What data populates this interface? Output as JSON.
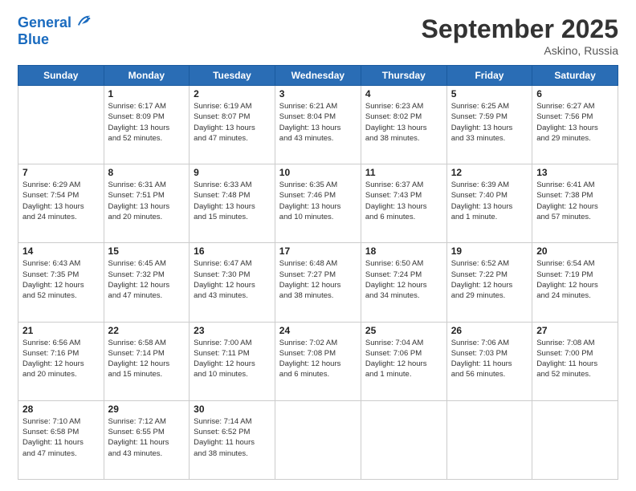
{
  "logo": {
    "line1": "General",
    "line2": "Blue"
  },
  "title": "September 2025",
  "location": "Askino, Russia",
  "headers": [
    "Sunday",
    "Monday",
    "Tuesday",
    "Wednesday",
    "Thursday",
    "Friday",
    "Saturday"
  ],
  "weeks": [
    [
      {
        "day": "",
        "info": ""
      },
      {
        "day": "1",
        "info": "Sunrise: 6:17 AM\nSunset: 8:09 PM\nDaylight: 13 hours\nand 52 minutes."
      },
      {
        "day": "2",
        "info": "Sunrise: 6:19 AM\nSunset: 8:07 PM\nDaylight: 13 hours\nand 47 minutes."
      },
      {
        "day": "3",
        "info": "Sunrise: 6:21 AM\nSunset: 8:04 PM\nDaylight: 13 hours\nand 43 minutes."
      },
      {
        "day": "4",
        "info": "Sunrise: 6:23 AM\nSunset: 8:02 PM\nDaylight: 13 hours\nand 38 minutes."
      },
      {
        "day": "5",
        "info": "Sunrise: 6:25 AM\nSunset: 7:59 PM\nDaylight: 13 hours\nand 33 minutes."
      },
      {
        "day": "6",
        "info": "Sunrise: 6:27 AM\nSunset: 7:56 PM\nDaylight: 13 hours\nand 29 minutes."
      }
    ],
    [
      {
        "day": "7",
        "info": "Sunrise: 6:29 AM\nSunset: 7:54 PM\nDaylight: 13 hours\nand 24 minutes."
      },
      {
        "day": "8",
        "info": "Sunrise: 6:31 AM\nSunset: 7:51 PM\nDaylight: 13 hours\nand 20 minutes."
      },
      {
        "day": "9",
        "info": "Sunrise: 6:33 AM\nSunset: 7:48 PM\nDaylight: 13 hours\nand 15 minutes."
      },
      {
        "day": "10",
        "info": "Sunrise: 6:35 AM\nSunset: 7:46 PM\nDaylight: 13 hours\nand 10 minutes."
      },
      {
        "day": "11",
        "info": "Sunrise: 6:37 AM\nSunset: 7:43 PM\nDaylight: 13 hours\nand 6 minutes."
      },
      {
        "day": "12",
        "info": "Sunrise: 6:39 AM\nSunset: 7:40 PM\nDaylight: 13 hours\nand 1 minute."
      },
      {
        "day": "13",
        "info": "Sunrise: 6:41 AM\nSunset: 7:38 PM\nDaylight: 12 hours\nand 57 minutes."
      }
    ],
    [
      {
        "day": "14",
        "info": "Sunrise: 6:43 AM\nSunset: 7:35 PM\nDaylight: 12 hours\nand 52 minutes."
      },
      {
        "day": "15",
        "info": "Sunrise: 6:45 AM\nSunset: 7:32 PM\nDaylight: 12 hours\nand 47 minutes."
      },
      {
        "day": "16",
        "info": "Sunrise: 6:47 AM\nSunset: 7:30 PM\nDaylight: 12 hours\nand 43 minutes."
      },
      {
        "day": "17",
        "info": "Sunrise: 6:48 AM\nSunset: 7:27 PM\nDaylight: 12 hours\nand 38 minutes."
      },
      {
        "day": "18",
        "info": "Sunrise: 6:50 AM\nSunset: 7:24 PM\nDaylight: 12 hours\nand 34 minutes."
      },
      {
        "day": "19",
        "info": "Sunrise: 6:52 AM\nSunset: 7:22 PM\nDaylight: 12 hours\nand 29 minutes."
      },
      {
        "day": "20",
        "info": "Sunrise: 6:54 AM\nSunset: 7:19 PM\nDaylight: 12 hours\nand 24 minutes."
      }
    ],
    [
      {
        "day": "21",
        "info": "Sunrise: 6:56 AM\nSunset: 7:16 PM\nDaylight: 12 hours\nand 20 minutes."
      },
      {
        "day": "22",
        "info": "Sunrise: 6:58 AM\nSunset: 7:14 PM\nDaylight: 12 hours\nand 15 minutes."
      },
      {
        "day": "23",
        "info": "Sunrise: 7:00 AM\nSunset: 7:11 PM\nDaylight: 12 hours\nand 10 minutes."
      },
      {
        "day": "24",
        "info": "Sunrise: 7:02 AM\nSunset: 7:08 PM\nDaylight: 12 hours\nand 6 minutes."
      },
      {
        "day": "25",
        "info": "Sunrise: 7:04 AM\nSunset: 7:06 PM\nDaylight: 12 hours\nand 1 minute."
      },
      {
        "day": "26",
        "info": "Sunrise: 7:06 AM\nSunset: 7:03 PM\nDaylight: 11 hours\nand 56 minutes."
      },
      {
        "day": "27",
        "info": "Sunrise: 7:08 AM\nSunset: 7:00 PM\nDaylight: 11 hours\nand 52 minutes."
      }
    ],
    [
      {
        "day": "28",
        "info": "Sunrise: 7:10 AM\nSunset: 6:58 PM\nDaylight: 11 hours\nand 47 minutes."
      },
      {
        "day": "29",
        "info": "Sunrise: 7:12 AM\nSunset: 6:55 PM\nDaylight: 11 hours\nand 43 minutes."
      },
      {
        "day": "30",
        "info": "Sunrise: 7:14 AM\nSunset: 6:52 PM\nDaylight: 11 hours\nand 38 minutes."
      },
      {
        "day": "",
        "info": ""
      },
      {
        "day": "",
        "info": ""
      },
      {
        "day": "",
        "info": ""
      },
      {
        "day": "",
        "info": ""
      }
    ]
  ]
}
